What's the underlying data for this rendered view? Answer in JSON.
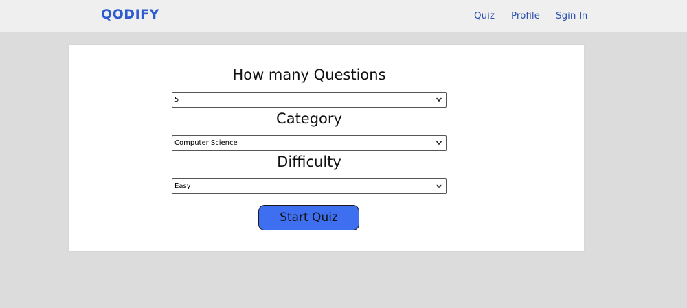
{
  "header": {
    "logo": "QODIFY",
    "nav": {
      "quiz": "Quiz",
      "profile": "Profile",
      "signin": "Sgin In"
    }
  },
  "form": {
    "questions": {
      "label": "How many Questions",
      "value": "5",
      "icon": "chevron-down-icon"
    },
    "category": {
      "label": "Category",
      "value": "Computer Science",
      "icon": "chevron-down-icon"
    },
    "difficulty": {
      "label": "Difficulty",
      "value": "Easy",
      "icon": "chevron-down-icon"
    },
    "start_button": "Start Quiz"
  },
  "colors": {
    "accent": "#2d5bd0",
    "button": "#3d6ff0",
    "page_background": "#dddcdc",
    "navbar_background": "#efefef"
  }
}
